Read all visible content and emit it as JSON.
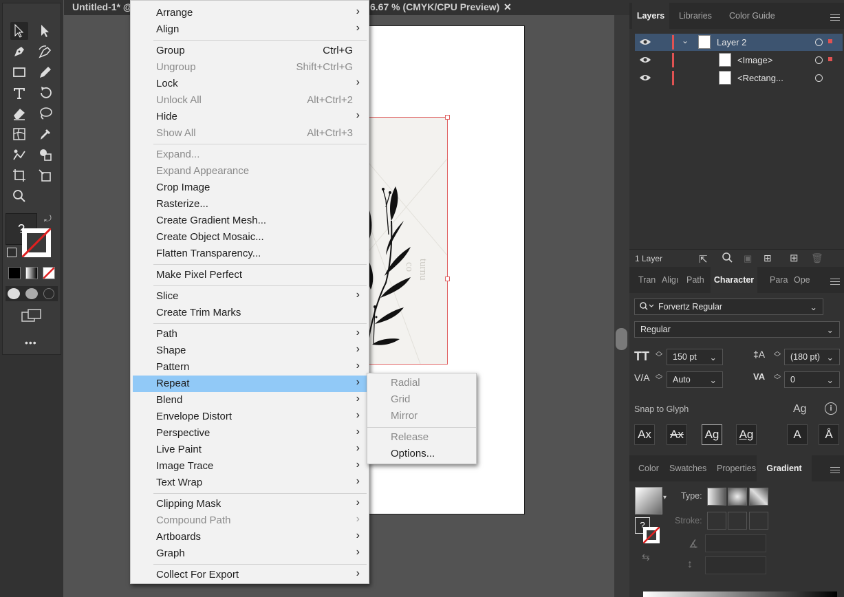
{
  "document": {
    "tab_left": "Untitled-1* @",
    "tab_right": "6.67 % (CMYK/CPU Preview)",
    "close_glyph": "✕"
  },
  "toolbar": {
    "tools": [
      "selection-tool",
      "direct-selection-tool",
      "pen-tool",
      "curvature-tool",
      "rectangle-tool",
      "pencil-tool",
      "type-tool",
      "rotate-tool",
      "eraser-tool",
      "lasso-tool",
      "mesh-tool",
      "eyedropper-tool",
      "puppet-warp-tool",
      "shape-builder-tool",
      "artboard-tool",
      "free-transform-tool",
      "zoom-tool"
    ],
    "unknown_fill": "?",
    "more": "•••"
  },
  "context_menu": {
    "groups": [
      [
        {
          "label": "Arrange",
          "shortcut": "",
          "submenu": true,
          "disabled": false
        },
        {
          "label": "Align",
          "shortcut": "",
          "submenu": true,
          "disabled": false
        }
      ],
      [
        {
          "label": "Group",
          "shortcut": "Ctrl+G",
          "submenu": false,
          "disabled": false
        },
        {
          "label": "Ungroup",
          "shortcut": "Shift+Ctrl+G",
          "submenu": false,
          "disabled": true
        },
        {
          "label": "Lock",
          "shortcut": "",
          "submenu": true,
          "disabled": false
        },
        {
          "label": "Unlock All",
          "shortcut": "Alt+Ctrl+2",
          "submenu": false,
          "disabled": true
        },
        {
          "label": "Hide",
          "shortcut": "",
          "submenu": true,
          "disabled": false
        },
        {
          "label": "Show All",
          "shortcut": "Alt+Ctrl+3",
          "submenu": false,
          "disabled": true
        }
      ],
      [
        {
          "label": "Expand...",
          "shortcut": "",
          "submenu": false,
          "disabled": true
        },
        {
          "label": "Expand Appearance",
          "shortcut": "",
          "submenu": false,
          "disabled": true
        },
        {
          "label": "Crop Image",
          "shortcut": "",
          "submenu": false,
          "disabled": false
        },
        {
          "label": "Rasterize...",
          "shortcut": "",
          "submenu": false,
          "disabled": false
        },
        {
          "label": "Create Gradient Mesh...",
          "shortcut": "",
          "submenu": false,
          "disabled": false
        },
        {
          "label": "Create Object Mosaic...",
          "shortcut": "",
          "submenu": false,
          "disabled": false
        },
        {
          "label": "Flatten Transparency...",
          "shortcut": "",
          "submenu": false,
          "disabled": false
        }
      ],
      [
        {
          "label": "Make Pixel Perfect",
          "shortcut": "",
          "submenu": false,
          "disabled": false
        }
      ],
      [
        {
          "label": "Slice",
          "shortcut": "",
          "submenu": true,
          "disabled": false
        },
        {
          "label": "Create Trim Marks",
          "shortcut": "",
          "submenu": false,
          "disabled": false
        }
      ],
      [
        {
          "label": "Path",
          "shortcut": "",
          "submenu": true,
          "disabled": false
        },
        {
          "label": "Shape",
          "shortcut": "",
          "submenu": true,
          "disabled": false
        },
        {
          "label": "Pattern",
          "shortcut": "",
          "submenu": true,
          "disabled": false
        },
        {
          "label": "Repeat",
          "shortcut": "",
          "submenu": true,
          "disabled": false,
          "highlighted": true
        },
        {
          "label": "Blend",
          "shortcut": "",
          "submenu": true,
          "disabled": false
        },
        {
          "label": "Envelope Distort",
          "shortcut": "",
          "submenu": true,
          "disabled": false
        },
        {
          "label": "Perspective",
          "shortcut": "",
          "submenu": true,
          "disabled": false
        },
        {
          "label": "Live Paint",
          "shortcut": "",
          "submenu": true,
          "disabled": false
        },
        {
          "label": "Image Trace",
          "shortcut": "",
          "submenu": true,
          "disabled": false
        },
        {
          "label": "Text Wrap",
          "shortcut": "",
          "submenu": true,
          "disabled": false
        }
      ],
      [
        {
          "label": "Clipping Mask",
          "shortcut": "",
          "submenu": true,
          "disabled": false
        },
        {
          "label": "Compound Path",
          "shortcut": "",
          "submenu": true,
          "disabled": true
        },
        {
          "label": "Artboards",
          "shortcut": "",
          "submenu": true,
          "disabled": false
        },
        {
          "label": "Graph",
          "shortcut": "",
          "submenu": true,
          "disabled": false
        }
      ],
      [
        {
          "label": "Collect For Export",
          "shortcut": "",
          "submenu": true,
          "disabled": false
        }
      ]
    ],
    "submenu_arrow": "›",
    "highlight_color": "#91c9f7"
  },
  "repeat_submenu": {
    "groups": [
      [
        {
          "label": "Radial",
          "disabled": true
        },
        {
          "label": "Grid",
          "disabled": true
        },
        {
          "label": "Mirror",
          "disabled": true
        }
      ],
      [
        {
          "label": "Release",
          "disabled": true
        },
        {
          "label": "Options...",
          "disabled": false
        }
      ]
    ]
  },
  "layers_panel": {
    "tabs": [
      "Layers",
      "Libraries",
      "Color Guide"
    ],
    "active_tab": "Layers",
    "rows": [
      {
        "name": "Layer 2",
        "selected": true,
        "expanded": true
      },
      {
        "name": "<Image>",
        "selected": false
      },
      {
        "name": "<Rectang...",
        "selected": false
      }
    ],
    "footer_count": "1 Layer",
    "layer_color": "#e05252"
  },
  "character_panel": {
    "tabs": [
      "Tran",
      "Aligı",
      "Path",
      "Character",
      "Para",
      "Ope"
    ],
    "active_tab": "Character",
    "font_family": "Forvertz Regular",
    "font_style": "Regular",
    "font_size": "150 pt",
    "leading": "(180 pt)",
    "kerning": "Auto",
    "tracking": "0",
    "snap_label": "Snap to Glyph",
    "snap_buttons": [
      "Ax",
      "Ax",
      "Ag",
      "Ag",
      "A",
      "Å"
    ]
  },
  "gradient_panel": {
    "tabs": [
      "Color",
      "Swatches",
      "Properties",
      "Gradient"
    ],
    "active_tab": "Gradient",
    "type_label": "Type:",
    "stroke_label": "Stroke:",
    "unknown_fill": "?"
  }
}
